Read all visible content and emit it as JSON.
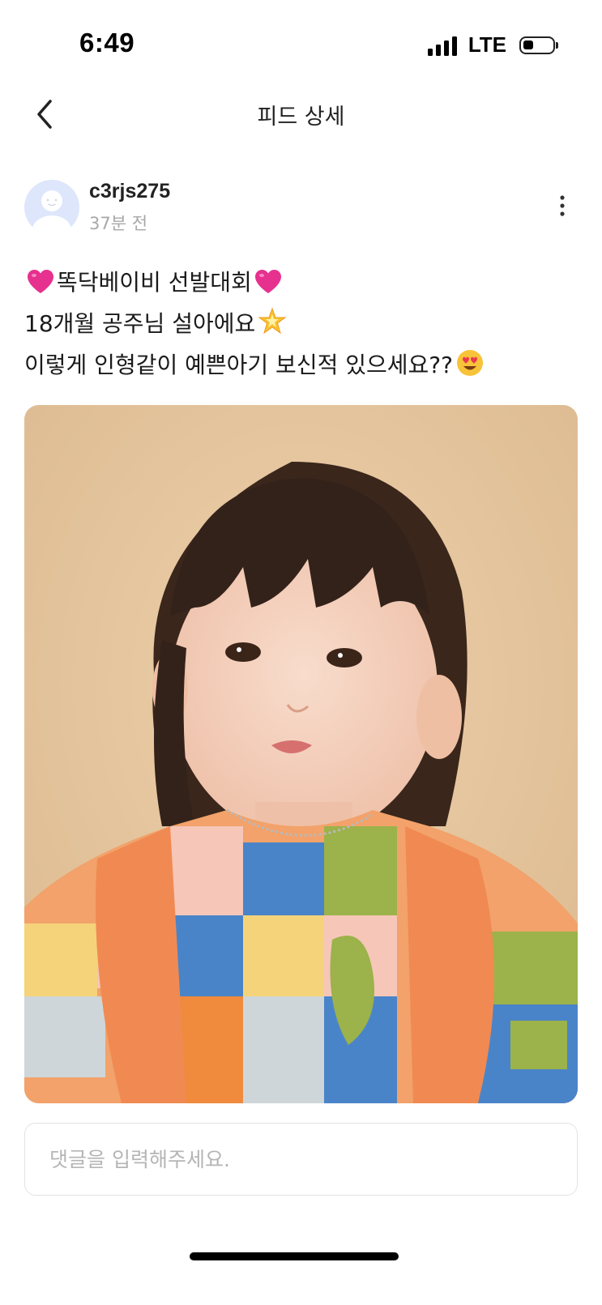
{
  "status_bar": {
    "time": "6:49",
    "network": "LTE",
    "signal_bars": 4,
    "battery_level": 0.35
  },
  "nav": {
    "title": "피드 상세",
    "back_icon": "chevron-left-icon"
  },
  "post": {
    "author": {
      "username": "c3rjs275",
      "time_ago": "37분 전",
      "avatar_icon": "default-avatar-icon"
    },
    "more_icon": "vertical-dots-icon",
    "lines": [
      {
        "before": "",
        "text": "똑닥베이비 선발대회",
        "emoji_before": "pink-heart-icon",
        "emoji_after": "pink-heart-icon"
      },
      {
        "text": "18개월 공주님 설아에요",
        "emoji_after": "glowing-star-icon"
      },
      {
        "text": "이렇게 인형같이 예쁜아기 보신적 있으세요??",
        "emoji_after": "heart-eyes-face-icon"
      }
    ],
    "photo_description_icon": "baby-portrait-photo"
  },
  "comment": {
    "placeholder": "댓글을 입력해주세요.",
    "value": ""
  },
  "colors": {
    "background": "#ffffff",
    "photo_backdrop": "#e6c7a0",
    "muted_text": "#a8a8a8",
    "input_border": "#e3e3e3",
    "heart": "#e6318f"
  }
}
